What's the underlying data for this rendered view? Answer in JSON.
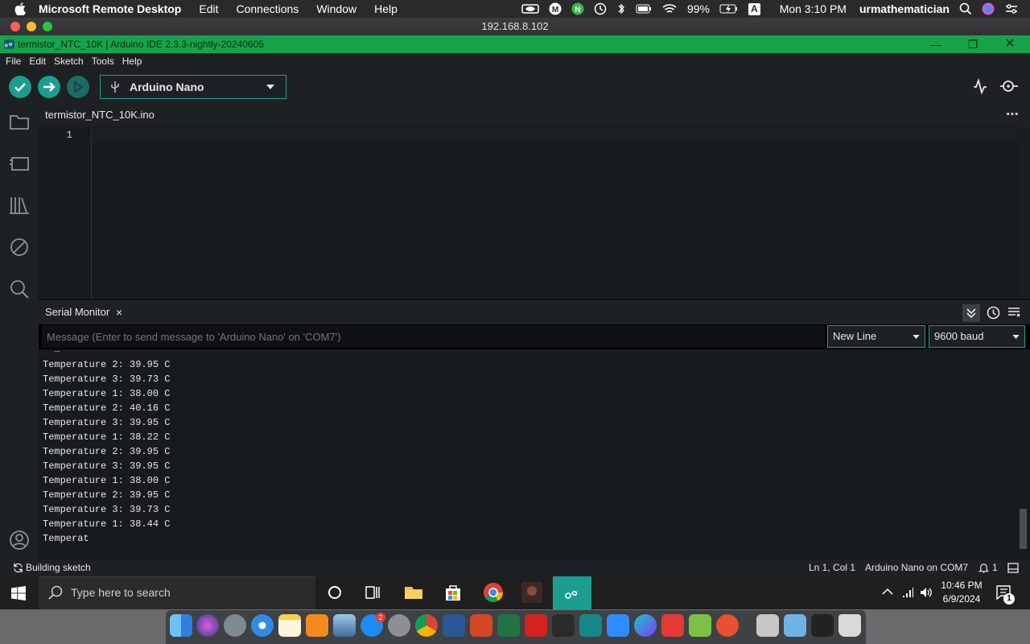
{
  "mac_menubar": {
    "app_name": "Microsoft Remote Desktop",
    "menus": [
      "Edit",
      "Connections",
      "Window",
      "Help"
    ],
    "battery": "99%",
    "input_letter": "A",
    "clock": "Mon 3:10 PM",
    "user": "urmathematician",
    "status_icons": [
      "nvidia-icon",
      "m-icon",
      "n-icon",
      "time-machine-icon",
      "bluetooth-icon",
      "battery-icon",
      "wifi-icon",
      "input-source-icon",
      "search-icon",
      "siri-icon",
      "control-center-icon"
    ]
  },
  "remote_window": {
    "title": "192.168.8.102"
  },
  "arduino_window": {
    "title": "termistor_NTC_10K | Arduino IDE 2.3.3-nightly-20240605"
  },
  "ide_menu": [
    "File",
    "Edit",
    "Sketch",
    "Tools",
    "Help"
  ],
  "toolbar": {
    "board": "Arduino Nano"
  },
  "editor": {
    "file_tab": "termistor_NTC_10K.ino",
    "line_numbers": [
      "1"
    ]
  },
  "serial_monitor": {
    "title": "Serial Monitor",
    "close": "×",
    "message_placeholder": "Message (Enter to send message to 'Arduino Nano' on 'COM7')",
    "line_ending": "New Line",
    "baud": "9600 baud",
    "output": [
      "Temperature 2: 39.95 C",
      "Temperature 3: 39.73 C",
      "Temperature 1: 38.00 C",
      "Temperature 2: 40.16 C",
      "Temperature 3: 39.95 C",
      "Temperature 1: 38.22 C",
      "Temperature 2: 39.95 C",
      "Temperature 3: 39.95 C",
      "Temperature 1: 38.00 C",
      "Temperature 2: 39.95 C",
      "Temperature 3: 39.73 C",
      "Temperature 1: 38.44 C",
      "Temperat"
    ]
  },
  "status_bar": {
    "build": "Building sketch",
    "position": "Ln 1, Col 1",
    "board_port": "Arduino Nano on COM7",
    "notifications": "1"
  },
  "windows_taskbar": {
    "search_placeholder": "Type here to search",
    "time": "10:46 PM",
    "date": "6/9/2024",
    "notification_count": "1"
  },
  "dock": {
    "app_store_badge": "2",
    "apps": [
      "finder",
      "siri",
      "launchpad",
      "safari",
      "notes",
      "books",
      "preview",
      "app-store",
      "system-preferences",
      "chrome",
      "word",
      "powerpoint",
      "excel",
      "mendeley",
      "pointerfocus",
      "arduino",
      "zoom",
      "canva",
      "photo-booth",
      "telegraph",
      "remote-desktop",
      "screenshot",
      "folder",
      "terminal",
      "trash"
    ]
  },
  "colors": {
    "arduino_green": "#17a34a",
    "teal": "#1b9e8f",
    "ide_bg": "#1e2124"
  }
}
